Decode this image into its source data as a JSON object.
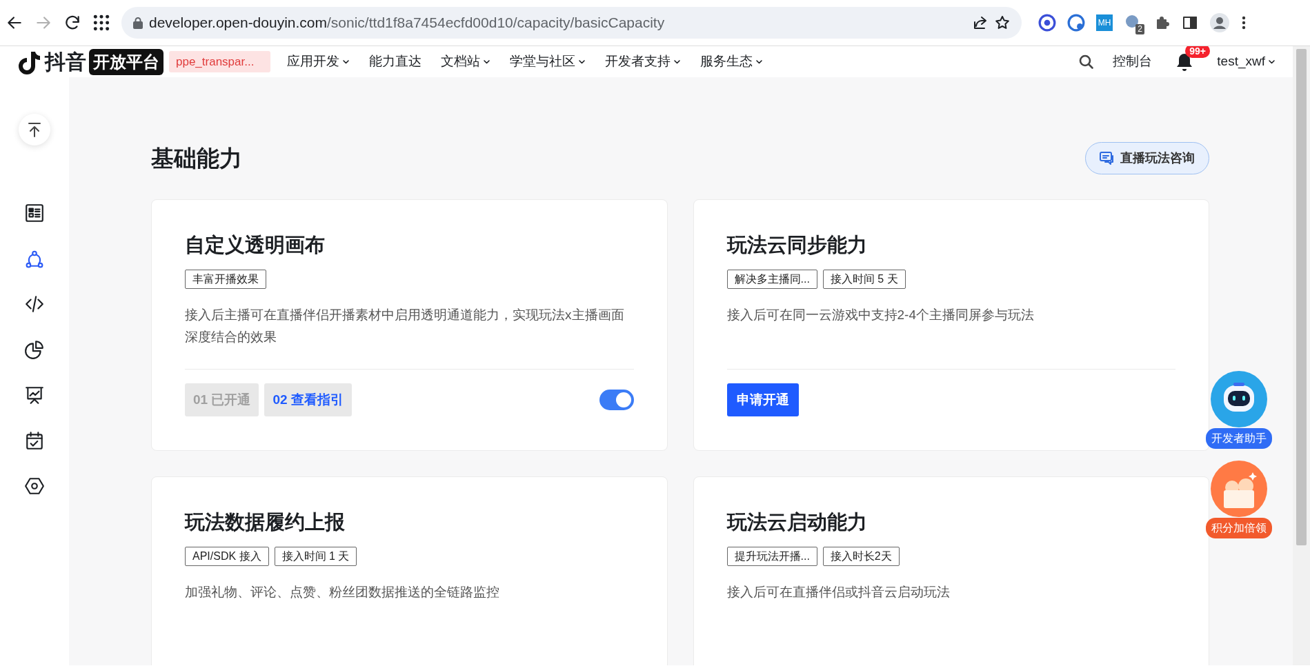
{
  "browser": {
    "url_domain": "developer.open-douyin.com",
    "url_path": "/sonic/ttd1f8a7454ecfd00d10/capacity/basicCapacity",
    "forward_disabled": true,
    "extensions": [
      {
        "kind": "swirl"
      },
      {
        "kind": "globe"
      },
      {
        "kind": "label",
        "text": "MH"
      },
      {
        "kind": "badge",
        "text": "2"
      },
      {
        "kind": "puzzle"
      }
    ]
  },
  "nav": {
    "logo_text": "抖音",
    "logo_badge": "开放平台",
    "env_tag": "ppe_transpar...",
    "menu": [
      {
        "label": "应用开发",
        "dropdown": true
      },
      {
        "label": "能力直达",
        "dropdown": false
      },
      {
        "label": "文档站",
        "dropdown": true
      },
      {
        "label": "学堂与社区",
        "dropdown": true
      },
      {
        "label": "开发者支持",
        "dropdown": true
      },
      {
        "label": "服务生态",
        "dropdown": true
      }
    ],
    "console": "控制台",
    "notification_count": "99+",
    "user": "test_xwf"
  },
  "sidebar": {
    "items": [
      {
        "kind": "list",
        "selected": false
      },
      {
        "kind": "nodes",
        "selected": true
      },
      {
        "kind": "code",
        "selected": false
      },
      {
        "kind": "pie",
        "selected": false
      },
      {
        "kind": "board",
        "selected": false
      },
      {
        "kind": "calendar",
        "selected": false
      },
      {
        "kind": "hexagon",
        "selected": false
      }
    ]
  },
  "page": {
    "title": "基础能力",
    "consult_button": "直播玩法咨询"
  },
  "cards": [
    {
      "title": "自定义透明画布",
      "tags": [
        "丰富开播效果"
      ],
      "description": "接入后主播可在直播伴侣开播素材中启用透明通道能力，实现玩法x主播画面深度结合的效果",
      "footer": {
        "kind": "steps",
        "steps": [
          {
            "label": "01 已开通",
            "done": true
          },
          {
            "label": "02 查看指引",
            "done": false
          }
        ],
        "toggle_on": true
      }
    },
    {
      "title": "玩法云同步能力",
      "tags": [
        "解决多主播同...",
        "接入时间 5 天"
      ],
      "description": "接入后可在同一云游戏中支持2-4个主播同屏参与玩法",
      "footer": {
        "kind": "button",
        "label": "申请开通"
      }
    },
    {
      "title": "玩法数据履约上报",
      "tags": [
        "API/SDK 接入",
        "接入时间 1 天"
      ],
      "description": "加强礼物、评论、点赞、粉丝团数据推送的全链路监控"
    },
    {
      "title": "玩法云启动能力",
      "tags": [
        "提升玩法开播...",
        "接入时长2天"
      ],
      "description": "接入后可在直播伴侣或抖音云启动玩法"
    }
  ],
  "floating": [
    {
      "kind": "assistant",
      "label": "开发者助手"
    },
    {
      "kind": "reward",
      "label": "积分加倍领"
    }
  ]
}
